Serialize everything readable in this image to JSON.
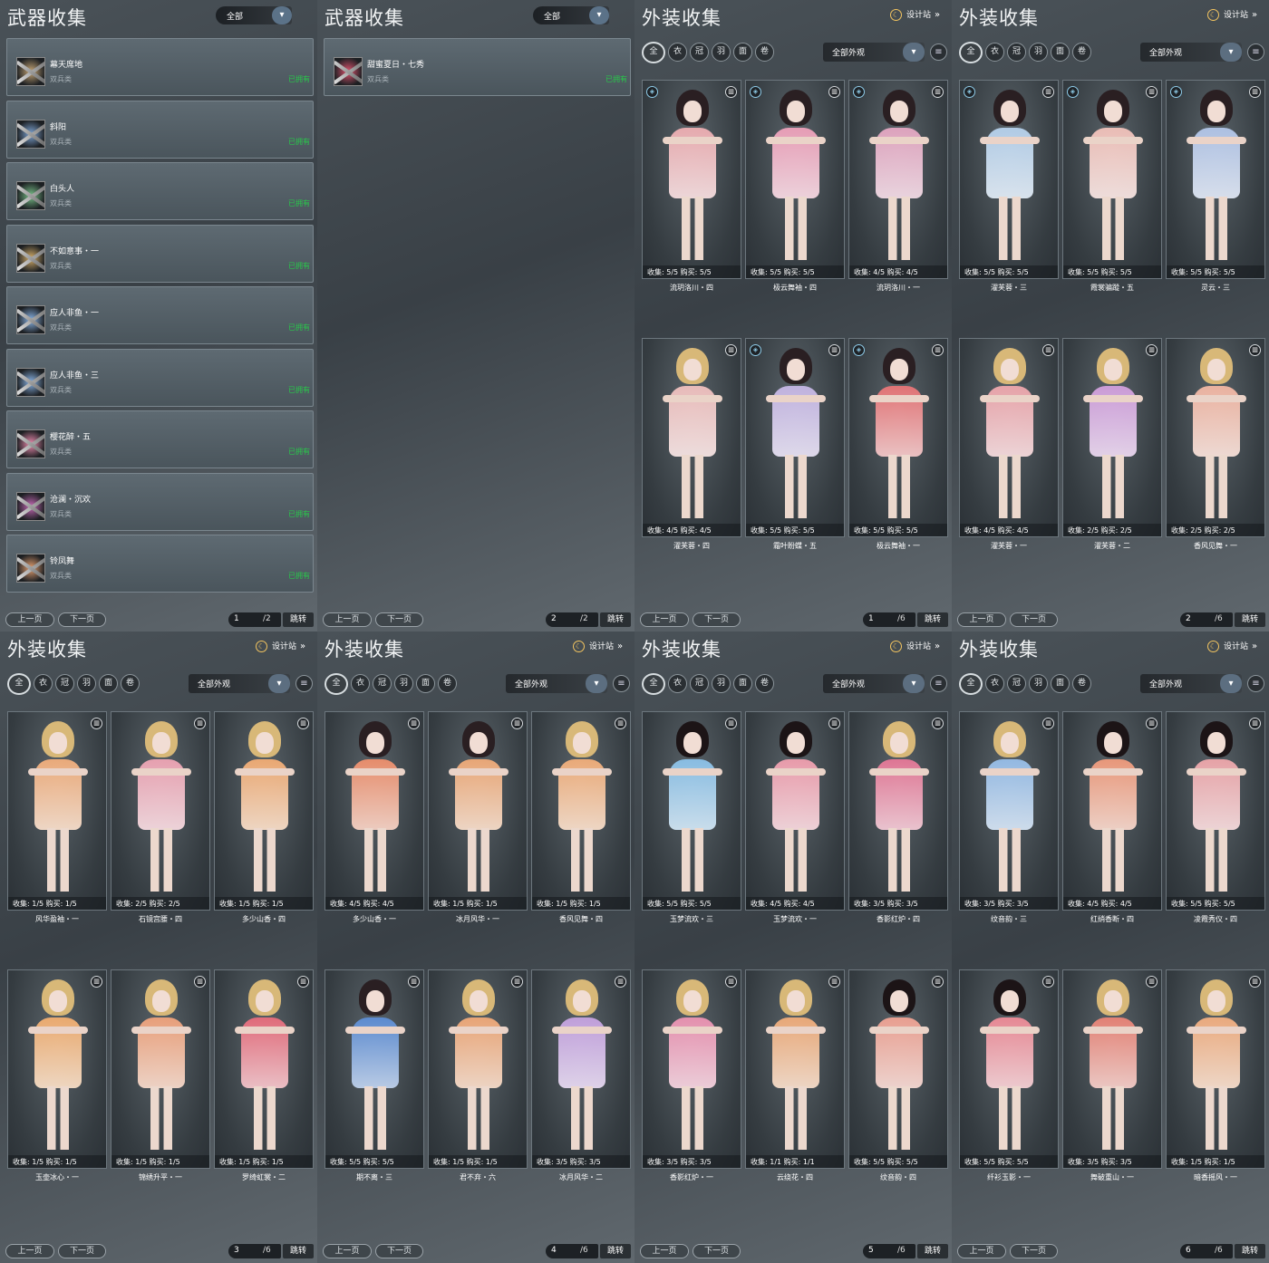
{
  "design_label": "设计站",
  "pager": {
    "prev": "上一页",
    "next": "下一页",
    "jump": "跳转"
  },
  "panels": [
    {
      "kind": "weapon",
      "title": "武器收集",
      "filter": "全部",
      "page": "1",
      "total": "/2",
      "items": [
        {
          "name": "幕天席地",
          "type": "双兵类",
          "status": "已拥有",
          "color": "#c9a877"
        },
        {
          "name": "斜阳",
          "type": "双兵类",
          "status": "已拥有",
          "color": "#7fa6d6"
        },
        {
          "name": "白头人",
          "type": "双兵类",
          "status": "已拥有",
          "color": "#7ac28a"
        },
        {
          "name": "不如意事・一",
          "type": "双兵类",
          "status": "已拥有",
          "color": "#d8b06a"
        },
        {
          "name": "应人非鱼・一",
          "type": "双兵类",
          "status": "已拥有",
          "color": "#8ab4e6"
        },
        {
          "name": "应人非鱼・三",
          "type": "双兵类",
          "status": "已拥有",
          "color": "#8ab4e6"
        },
        {
          "name": "樱花醉・五",
          "type": "双兵类",
          "status": "已拥有",
          "color": "#f08cb0"
        },
        {
          "name": "沧澜・沉欢",
          "type": "双兵类",
          "status": "已拥有",
          "color": "#c86ab8"
        },
        {
          "name": "铃凤舞",
          "type": "双兵类",
          "status": "已拥有",
          "color": "#e6a070"
        }
      ]
    },
    {
      "kind": "weapon",
      "title": "武器收集",
      "filter": "全部",
      "page": "2",
      "total": "/2",
      "items": [
        {
          "name": "甜蜜夏日・七秀",
          "type": "双兵类",
          "status": "已拥有",
          "color": "#e05470"
        }
      ]
    },
    {
      "kind": "outfit",
      "title": "外装收集",
      "filter": "全部外观",
      "page": "1",
      "total": "/6",
      "cards": [
        {
          "name": "流玥洛川・四",
          "stats": "收集: 5/5 购买: 5/5",
          "hair": "#2a1f22",
          "dress": "#f2b0b4",
          "badge": true
        },
        {
          "name": "极云舞袖・四",
          "stats": "收集: 5/5 购买: 5/5",
          "hair": "#2a1f22",
          "dress": "#f2a2bc",
          "badge": true
        },
        {
          "name": "流玥洛川・一",
          "stats": "收集: 4/5 购买: 4/5",
          "hair": "#2a1f22",
          "dress": "#e8a8c4",
          "badge": true
        },
        {
          "name": "濯芙蓉・四",
          "stats": "收集: 4/5 购买: 4/5",
          "hair": "#d8b878",
          "dress": "#f4c2c0",
          "badge": false
        },
        {
          "name": "霜叶盼蝶・五",
          "stats": "收集: 5/5 购买: 5/5",
          "hair": "#2a1f22",
          "dress": "#c8b8e8",
          "badge": true
        },
        {
          "name": "极云舞袖・一",
          "stats": "收集: 5/5 购买: 5/5",
          "hair": "#2a1f22",
          "dress": "#ec7476",
          "badge": true
        }
      ]
    },
    {
      "kind": "outfit",
      "title": "外装收集",
      "filter": "全部外观",
      "page": "2",
      "total": "/6",
      "cards": [
        {
          "name": "濯芙蓉・三",
          "stats": "收集: 5/5 购买: 5/5",
          "hair": "#2a1f22",
          "dress": "#b8d4f0",
          "badge": true
        },
        {
          "name": "霞裳骗蹤・五",
          "stats": "收集: 5/5 购买: 5/5",
          "hair": "#2a1f22",
          "dress": "#f6c4bc",
          "badge": true
        },
        {
          "name": "灵云・三",
          "stats": "收集: 5/5 购买: 5/5",
          "hair": "#2a1f22",
          "dress": "#b4c8ec",
          "badge": true
        },
        {
          "name": "濯芙蓉・一",
          "stats": "收集: 4/5 购买: 4/5",
          "hair": "#d8b878",
          "dress": "#f2a8ae",
          "badge": false
        },
        {
          "name": "濯芙蓉・二",
          "stats": "收集: 2/5 购买: 2/5",
          "hair": "#d8b878",
          "dress": "#d4a0e0",
          "badge": false
        },
        {
          "name": "香风见舞・一",
          "stats": "收集: 2/5 购买: 2/5",
          "hair": "#d8b878",
          "dress": "#f6b8a4",
          "badge": false
        }
      ]
    },
    {
      "kind": "outfit",
      "title": "外装收集",
      "filter": "全部外观",
      "page": "3",
      "total": "/6",
      "cards": [
        {
          "name": "风华盈袖・一",
          "stats": "收集: 1/5 购买: 1/5",
          "hair": "#d8b878",
          "dress": "#f6b07c",
          "badge": false
        },
        {
          "name": "石镜宫腰・四",
          "stats": "收集: 2/5 购买: 2/5",
          "hair": "#d8b878",
          "dress": "#f2a6b6",
          "badge": false
        },
        {
          "name": "多少山香・四",
          "stats": "收集: 1/5 购买: 1/5",
          "hair": "#d8b878",
          "dress": "#f6ae74",
          "badge": false
        },
        {
          "name": "玉壶冰心・一",
          "stats": "收集: 1/5 购买: 1/5",
          "hair": "#d8b878",
          "dress": "#f6b070",
          "badge": false
        },
        {
          "name": "锦绣升平・一",
          "stats": "收集: 1/5 购买: 1/5",
          "hair": "#d8b878",
          "dress": "#f4a47c",
          "badge": false
        },
        {
          "name": "罗绮虹裳・二",
          "stats": "收集: 1/5 购买: 1/5",
          "hair": "#d8b878",
          "dress": "#ec6c7c",
          "badge": false
        }
      ]
    },
    {
      "kind": "outfit",
      "title": "外装收集",
      "filter": "全部外观",
      "page": "4",
      "total": "/6",
      "cards": [
        {
          "name": "多少山香・一",
          "stats": "收集: 4/5 购买: 4/5",
          "hair": "#2a1f22",
          "dress": "#f2906c",
          "badge": false
        },
        {
          "name": "冰月风华・一",
          "stats": "收集: 1/5 购买: 1/5",
          "hair": "#2a1f22",
          "dress": "#f4ac78",
          "badge": false
        },
        {
          "name": "香风见舞・四",
          "stats": "收集: 1/5 购买: 1/5",
          "hair": "#d8b878",
          "dress": "#f6b07a",
          "badge": false
        },
        {
          "name": "期不离・三",
          "stats": "收集: 5/5 购买: 5/5",
          "hair": "#2a1f22",
          "dress": "#5c8ed8",
          "badge": false
        },
        {
          "name": "君不弃・六",
          "stats": "收集: 1/5 购买: 1/5",
          "hair": "#d8b878",
          "dress": "#f4aa78",
          "badge": false
        },
        {
          "name": "冰月风华・二",
          "stats": "收集: 3/5 购买: 3/5",
          "hair": "#d8b878",
          "dress": "#c8a4e4",
          "badge": false
        }
      ]
    },
    {
      "kind": "outfit",
      "title": "外装收集",
      "filter": "全部外观",
      "page": "5",
      "total": "/6",
      "cards": [
        {
          "name": "玉梦流欢・三",
          "stats": "收集: 5/5 购买: 5/5",
          "hair": "#1c1416",
          "dress": "#8cc4ec",
          "badge": false
        },
        {
          "name": "玉梦流欢・一",
          "stats": "收集: 4/5 购买: 4/5",
          "hair": "#1c1416",
          "dress": "#f4a0b0",
          "badge": false
        },
        {
          "name": "香影红炉・四",
          "stats": "收集: 3/5 购买: 3/5",
          "hair": "#d8b878",
          "dress": "#ea7898",
          "badge": false
        },
        {
          "name": "香影红炉・一",
          "stats": "收集: 3/5 购买: 3/5",
          "hair": "#d8b878",
          "dress": "#f094b4",
          "badge": false
        },
        {
          "name": "云绕花・四",
          "stats": "收集: 1/1 购买: 1/1",
          "hair": "#d8b878",
          "dress": "#f4ae7a",
          "badge": false
        },
        {
          "name": "纹音韵・四",
          "stats": "收集: 5/5 购买: 5/5",
          "hair": "#1c1416",
          "dress": "#f4a494",
          "badge": false
        }
      ]
    },
    {
      "kind": "outfit",
      "title": "外装收集",
      "filter": "全部外观",
      "page": "6",
      "total": "/6",
      "cards": [
        {
          "name": "纹音韵・三",
          "stats": "收集: 3/5 购买: 3/5",
          "hair": "#d8b878",
          "dress": "#98c0ec",
          "badge": false
        },
        {
          "name": "红绡香断・四",
          "stats": "收集: 4/5 购买: 4/5",
          "hair": "#1c1416",
          "dress": "#f49c7c",
          "badge": false
        },
        {
          "name": "凌霞秀仪・四",
          "stats": "收集: 5/5 购买: 5/5",
          "hair": "#1c1416",
          "dress": "#f2a8ac",
          "badge": false
        },
        {
          "name": "纤衫玉影・一",
          "stats": "收集: 5/5 购买: 5/5",
          "hair": "#1c1416",
          "dress": "#f28c98",
          "badge": false
        },
        {
          "name": "舞破重山・一",
          "stats": "收集: 3/5 购买: 3/5",
          "hair": "#d8b878",
          "dress": "#ee8476",
          "badge": false
        },
        {
          "name": "暗香摇风・一",
          "stats": "收集: 1/5 购买: 1/5",
          "hair": "#d8b878",
          "dress": "#f6b080",
          "badge": false
        }
      ]
    }
  ],
  "category_tabs": [
    {
      "icon": "all-outfit-icon",
      "glyph": "全"
    },
    {
      "icon": "clothes-icon",
      "glyph": "衣"
    },
    {
      "icon": "hat-icon",
      "glyph": "冠"
    },
    {
      "icon": "feather-icon",
      "glyph": "羽"
    },
    {
      "icon": "mask-icon",
      "glyph": "面"
    },
    {
      "icon": "scroll-icon",
      "glyph": "卷"
    }
  ]
}
